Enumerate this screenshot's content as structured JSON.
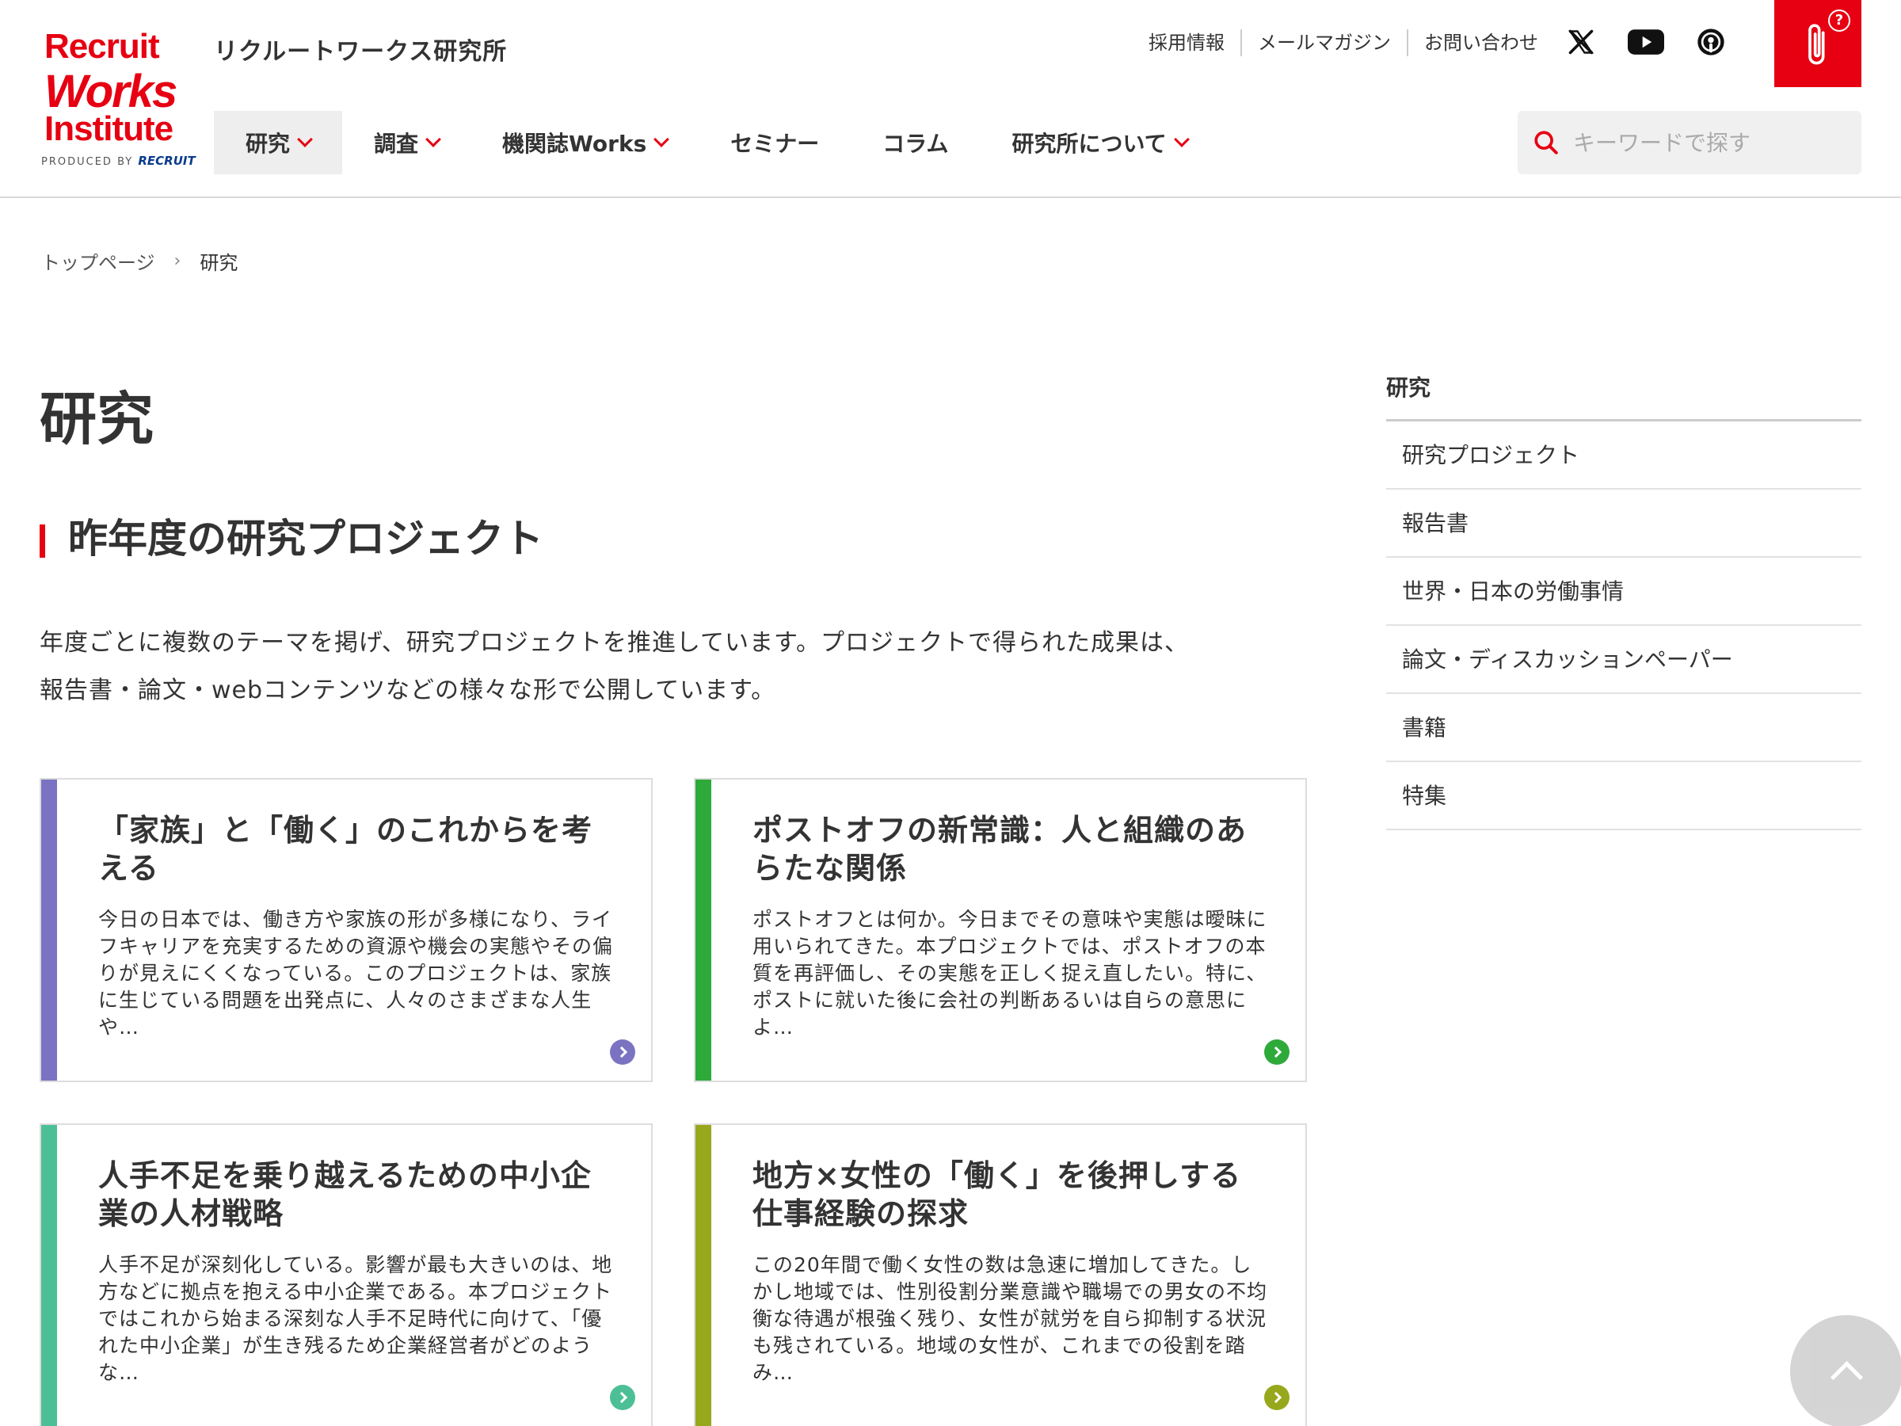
{
  "header": {
    "logo": {
      "line1": "Recruit",
      "line2": "Works",
      "line3": "Institute",
      "produced_by": "PRODUCED BY",
      "recruit": "RECRUIT"
    },
    "site_name": "リクルートワークス研究所",
    "util_links": [
      "採用情報",
      "メールマガジン",
      "お問い合わせ"
    ],
    "social_icons": [
      "x-icon",
      "youtube-icon",
      "podcast-icon"
    ],
    "help_icon": "paperclip-help-icon",
    "help_mark": "?",
    "nav": [
      {
        "label": "研究",
        "has_dropdown": true,
        "active": true
      },
      {
        "label": "調査",
        "has_dropdown": true
      },
      {
        "label": "機関誌Works",
        "has_dropdown": true
      },
      {
        "label": "セミナー",
        "has_dropdown": false
      },
      {
        "label": "コラム",
        "has_dropdown": false
      },
      {
        "label": "研究所について",
        "has_dropdown": true
      }
    ],
    "search": {
      "placeholder": "キーワードで探す",
      "value": ""
    }
  },
  "breadcrumb": {
    "home": "トップページ",
    "separator": "›",
    "current": "研究"
  },
  "main": {
    "page_title": "研究",
    "section_title": "昨年度の研究プロジェクト",
    "intro_line1": "年度ごとに複数のテーマを掲げ、研究プロジェクトを推進しています。プロジェクトで得られた成果は、",
    "intro_line2": "報告書・論文・webコンテンツなどの様々な形で公開しています。",
    "cards": [
      {
        "title": "「家族」と「働く」のこれからを考える",
        "text": "今日の日本では、働き方や家族の形が多様になり、ライフキャリアを充実するための資源や機会の実態やその偏りが見えにくくなっている。このプロジェクトは、家族に生じている問題を出発点に、人々のさまざまな人生や…",
        "color": "#7b73c2"
      },
      {
        "title": "ポストオフの新常識：人と組織のあらたな関係",
        "text": "ポストオフとは何か。今日までその意味や実態は曖昧に用いられてきた。本プロジェクトでは、ポストオフの本質を再評価し、その実態を正しく捉え直したい。特に、ポストに就いた後に会社の判断あるいは自らの意思によ…",
        "color": "#2eaa3a"
      },
      {
        "title": "人手不足を乗り越えるための中小企業の人材戦略",
        "text": "人手不足が深刻化している。影響が最も大きいのは、地方などに拠点を抱える中小企業である。本プロジェクトではこれから始まる深刻な人手不足時代に向けて、「優れた中小企業」が生き残るため企業経営者がどのような…",
        "color": "#4dbf96"
      },
      {
        "title": "地方×女性の「働く」を後押しする仕事経験の探求",
        "text": "この20年間で働く女性の数は急速に増加してきた。しかし地域では、性別役割分業意識や職場での男女の不均衡な待遇が根強く残り、女性が就労を自ら抑制する状況も残されている。地域の女性が、これまでの役割を踏み…",
        "color": "#98a81c"
      }
    ]
  },
  "sidebar": {
    "heading": "研究",
    "items": [
      "研究プロジェクト",
      "報告書",
      "世界・日本の労働事情",
      "論文・ディスカッションペーパー",
      "書籍",
      "特集"
    ]
  },
  "colors": {
    "brand_red": "#e60012",
    "text": "#333333",
    "border": "#dddddd"
  },
  "back_to_top_icon": "chevron-up-icon"
}
